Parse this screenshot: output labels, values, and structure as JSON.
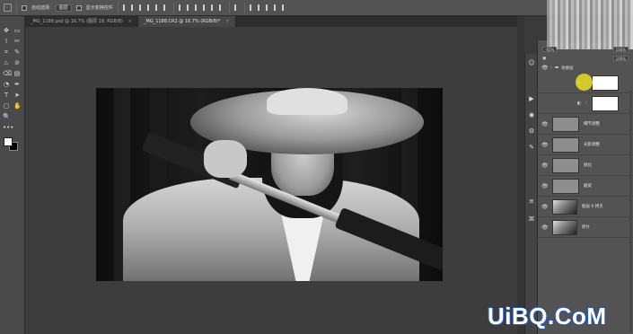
{
  "options_bar": {
    "auto_select_label": "自动选择:",
    "auto_select_value": "图层",
    "show_transform_label": "显示变换控件"
  },
  "tabs": [
    {
      "label": "_MG_1188.psd @ 16.7% (图层 18, RGB/8)",
      "close": "×"
    },
    {
      "label": "_MG_1188.CR2 @ 16.7% (RGB/8)*",
      "close": "×"
    }
  ],
  "toolbar": {
    "tool_glyphs": [
      "✥",
      "▭",
      "⌇",
      "✂",
      "⌗",
      "✎",
      "♨",
      "⊘",
      "⌫",
      "▤",
      "◔",
      "✒",
      "T",
      "➤",
      "▢",
      "✋",
      "🔍",
      "•••"
    ]
  },
  "colors": {
    "foreground": "#ffffff",
    "background": "#000000",
    "highlight_dot": "#e8df24"
  },
  "layers_panel": {
    "opacity_value": "100%",
    "fill_value": "100%",
    "zoom_value": "-65%",
    "group_name": "效果层",
    "layers": [
      {
        "name": "",
        "thumb": "white",
        "visible": true
      },
      {
        "name": "",
        "thumb": "white",
        "visible": true
      },
      {
        "name": "细节调整",
        "thumb": "gray",
        "visible": true
      },
      {
        "name": "光影调整",
        "thumb": "gray",
        "visible": true
      },
      {
        "name": "锐化",
        "thumb": "gray",
        "visible": true
      },
      {
        "name": "磨皮",
        "thumb": "gray",
        "visible": true
      },
      {
        "name": "图层 0 拷贝",
        "thumb": "photo",
        "visible": true
      },
      {
        "name": "原片",
        "thumb": "photo",
        "visible": true
      }
    ]
  },
  "dock_icons": [
    "person-icon",
    "play-icon",
    "color-wheel-icon",
    "adjust-icon",
    "brush-icon",
    "layers-icon",
    "paths-icon"
  ],
  "watermark": "UiBQ.CoM"
}
